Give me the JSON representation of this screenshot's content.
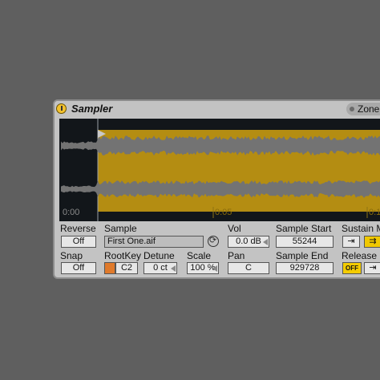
{
  "device": {
    "title": "Sampler",
    "zone_label": "Zone",
    "colors": {
      "background": "#5f5f5f",
      "panel": "#c3c3c3",
      "wave_bg": "#12161a",
      "wave_region": "#b48d12",
      "waveform": "#737373",
      "accent_yellow": "#f4cc00",
      "rootkey_swatch": "#e07a2b"
    }
  },
  "waveform": {
    "time_labels": [
      "0:00",
      "0:05",
      "0:1"
    ]
  },
  "controls": {
    "reverse": {
      "label": "Reverse",
      "value": "Off"
    },
    "sample": {
      "label": "Sample",
      "value": "First One.aif"
    },
    "vol": {
      "label": "Vol",
      "value": "0.0 dB"
    },
    "sample_start": {
      "label": "Sample Start",
      "value": "55244"
    },
    "sustain": {
      "label": "Sustain M"
    },
    "snap": {
      "label": "Snap",
      "value": "Off"
    },
    "rootkey": {
      "label": "RootKey",
      "value": "C2"
    },
    "detune": {
      "label": "Detune",
      "value": "0 ct"
    },
    "scale": {
      "label": "Scale",
      "value": "100 %"
    },
    "pan": {
      "label": "Pan",
      "value": "C"
    },
    "sample_end": {
      "label": "Sample End",
      "value": "929728"
    },
    "release": {
      "label": "Release",
      "toggle": "OFF"
    }
  }
}
